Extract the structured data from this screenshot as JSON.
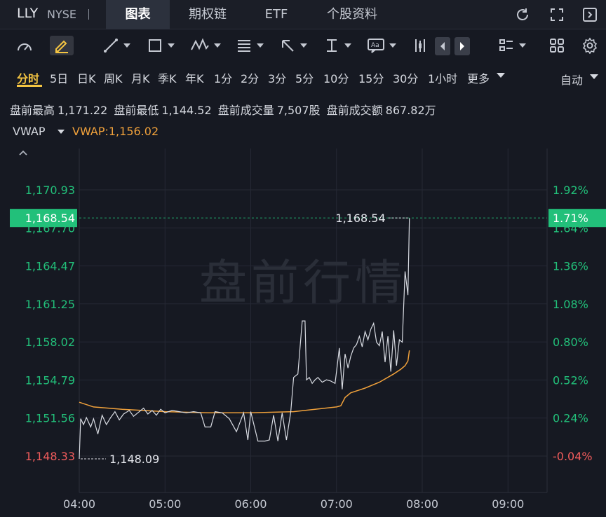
{
  "header": {
    "ticker": "LLY",
    "exchange": "NYSE",
    "tabs": [
      {
        "label": "图表",
        "active": true
      },
      {
        "label": "期权链",
        "active": false
      },
      {
        "label": "ETF",
        "active": false
      },
      {
        "label": "个股资料",
        "active": false
      }
    ],
    "icons": [
      "refresh-icon",
      "fullscreen-icon",
      "sidebar-icon"
    ]
  },
  "toolbar": {
    "tools": [
      "gauge-icon",
      "pen-icon",
      "line-tool-icon",
      "rect-tool-icon",
      "pattern-tool-icon",
      "fib-tool-icon",
      "arrow-tool-icon",
      "measure-tool-icon",
      "text-tool-icon",
      "candle-type-icon",
      "prev-icon",
      "next-icon",
      "indicator-list-icon",
      "layout-grid-icon",
      "settings-icon"
    ]
  },
  "periods": {
    "items": [
      "分时",
      "5日",
      "日K",
      "周K",
      "月K",
      "季K",
      "年K",
      "1分",
      "2分",
      "3分",
      "5分",
      "10分",
      "15分",
      "30分",
      "1小时",
      "更多"
    ],
    "active": "分时",
    "mode": "自动"
  },
  "stats": {
    "high_label": "盘前最高",
    "high": "1,171.22",
    "low_label": "盘前最低",
    "low": "1,144.52",
    "volume_label": "盘前成交量",
    "volume": "7,507股",
    "amount_label": "盘前成交额",
    "amount": "867.82万"
  },
  "indicator": {
    "name": "VWAP",
    "value_text": "VWAP:1,156.02"
  },
  "colors": {
    "up": "#22c07a",
    "down": "#f25c5c",
    "price_line": "#d9dce3",
    "vwap_line": "#f0a13b",
    "current_badge": "#22c07a",
    "accent": "#f5c542"
  },
  "chart_data": {
    "type": "line",
    "watermark": "盘前行情",
    "x_ticks": [
      "04:00",
      "05:00",
      "06:00",
      "07:00",
      "08:00",
      "09:00"
    ],
    "x_range": [
      "04:00",
      "09:30"
    ],
    "y_ticks": [
      "1,170.93",
      "1,167.70",
      "1,164.47",
      "1,161.25",
      "1,158.02",
      "1,154.79",
      "1,151.56",
      "1,148.33"
    ],
    "y_range": [
      1146.0,
      1173.5
    ],
    "pct_ticks": [
      "1.92%",
      "1.64%",
      "1.36%",
      "1.08%",
      "0.80%",
      "0.52%",
      "0.24%",
      "-0.04%"
    ],
    "current_price": "1,168.54",
    "current_pct": "1.71%",
    "current_value": 1168.54,
    "low_marker": {
      "label": "1,148.09",
      "value": 1148.09,
      "time": "04:00"
    },
    "high_marker": {
      "label": "1,168.54",
      "value": 1168.54,
      "time": "07:51"
    },
    "series": [
      {
        "name": "price",
        "x": [
          "04:00",
          "04:01",
          "04:03",
          "04:05",
          "04:08",
          "04:10",
          "04:13",
          "04:16",
          "04:19",
          "04:22",
          "04:25",
          "04:28",
          "04:31",
          "04:35",
          "04:38",
          "04:41",
          "04:45",
          "04:48",
          "04:51",
          "04:54",
          "04:57",
          "05:00",
          "05:05",
          "05:10",
          "05:15",
          "05:20",
          "05:25",
          "05:28",
          "05:32",
          "05:35",
          "05:40",
          "05:45",
          "05:50",
          "05:55",
          "05:58",
          "06:00",
          "06:05",
          "06:10",
          "06:13",
          "06:16",
          "06:19",
          "06:22",
          "06:25",
          "06:28",
          "06:30",
          "06:33",
          "06:36",
          "06:38",
          "06:39",
          "06:41",
          "06:43",
          "06:45",
          "06:47",
          "06:50",
          "06:53",
          "06:56",
          "06:59",
          "07:00",
          "07:02",
          "07:04",
          "07:06",
          "07:08",
          "07:10",
          "07:12",
          "07:14",
          "07:16",
          "07:18",
          "07:20",
          "07:22",
          "07:24",
          "07:26",
          "07:28",
          "07:30",
          "07:32",
          "07:34",
          "07:36",
          "07:38",
          "07:40",
          "07:42",
          "07:44",
          "07:46",
          "07:48",
          "07:50",
          "07:51"
        ],
        "values": [
          1148.09,
          1151.5,
          1151.0,
          1151.6,
          1150.8,
          1151.5,
          1150.2,
          1151.8,
          1151.0,
          1151.6,
          1152.1,
          1151.4,
          1151.9,
          1152.2,
          1151.7,
          1152.0,
          1152.4,
          1151.9,
          1152.2,
          1151.8,
          1152.3,
          1152.0,
          1152.2,
          1152.1,
          1152.0,
          1152.1,
          1152.0,
          1150.8,
          1150.8,
          1152.1,
          1152.0,
          1151.5,
          1150.4,
          1152.0,
          1149.7,
          1152.1,
          1149.6,
          1149.6,
          1149.7,
          1151.8,
          1149.6,
          1152.0,
          1149.7,
          1152.1,
          1155.0,
          1155.3,
          1159.8,
          1159.8,
          1154.8,
          1155.0,
          1154.5,
          1154.8,
          1155.0,
          1154.6,
          1154.8,
          1154.7,
          1154.5,
          1155.5,
          1157.5,
          1154.0,
          1157.0,
          1155.8,
          1156.8,
          1157.5,
          1157.8,
          1158.5,
          1157.6,
          1158.9,
          1158.2,
          1159.1,
          1159.6,
          1158.0,
          1157.7,
          1158.9,
          1156.3,
          1158.5,
          1155.5,
          1159.0,
          1156.0,
          1158.2,
          1158.0,
          1164.0,
          1162.0,
          1168.54
        ]
      },
      {
        "name": "VWAP",
        "x": [
          "04:00",
          "04:10",
          "04:30",
          "05:00",
          "05:30",
          "06:00",
          "06:30",
          "06:45",
          "07:00",
          "07:03",
          "07:06",
          "07:10",
          "07:20",
          "07:30",
          "07:40",
          "07:45",
          "07:48",
          "07:50",
          "07:51"
        ],
        "values": [
          1152.9,
          1152.5,
          1152.3,
          1152.1,
          1152.0,
          1152.0,
          1152.1,
          1152.3,
          1152.5,
          1152.6,
          1153.3,
          1153.7,
          1154.1,
          1154.6,
          1155.3,
          1155.7,
          1156.0,
          1156.4,
          1157.3
        ]
      }
    ]
  }
}
